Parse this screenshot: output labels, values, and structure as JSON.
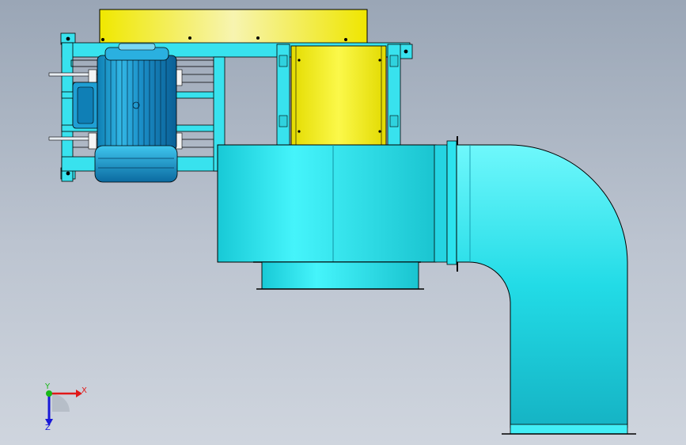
{
  "triad": {
    "x_label": "X",
    "y_label": "Y",
    "z_label": "Z",
    "x_color": "#e01818",
    "y_color": "#18b818",
    "z_color": "#1818d8"
  },
  "colors": {
    "background_top": "#9aa6b6",
    "background_bottom": "#cfd5de",
    "steel_cyan": "#2ee6ee",
    "guard_yellow": "#f3f000",
    "outline": "#000000"
  },
  "icons": {
    "motor": "electric-motor-icon",
    "fan": "centrifugal-fan-icon",
    "duct": "elbow-duct-icon"
  }
}
